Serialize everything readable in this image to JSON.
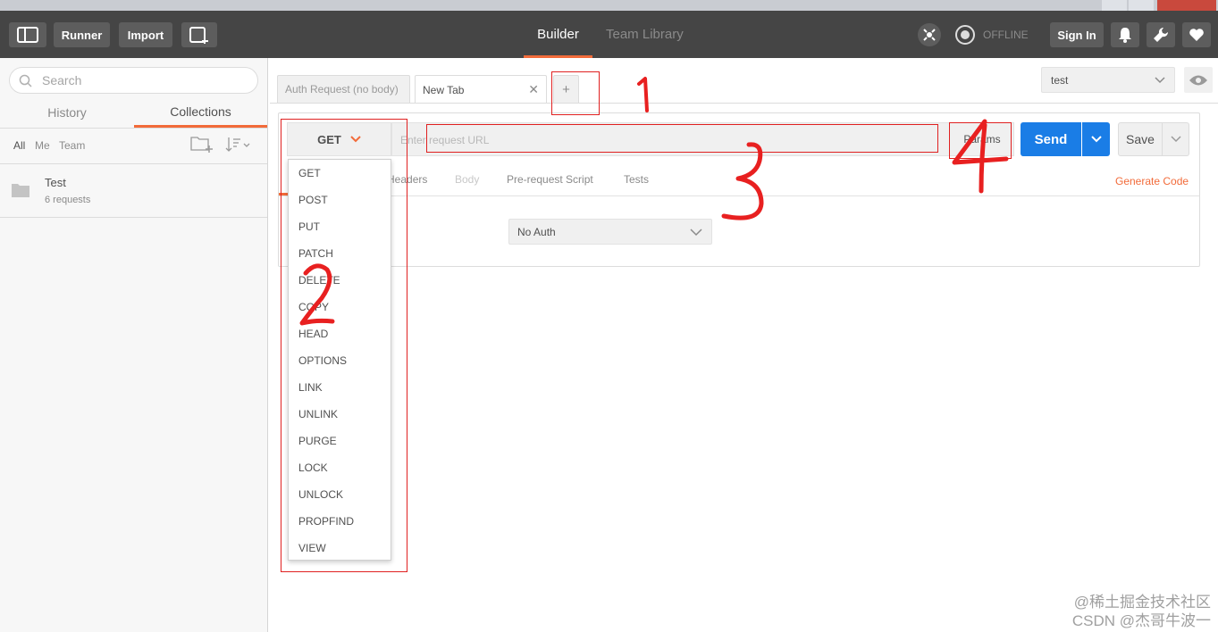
{
  "toolbar": {
    "runner_label": "Runner",
    "import_label": "Import",
    "tabs": {
      "builder": "Builder",
      "team_library": "Team Library"
    },
    "offline_label": "OFFLINE",
    "sign_in_label": "Sign In"
  },
  "sidebar": {
    "search_placeholder": "Search",
    "tabs": {
      "history": "History",
      "collections": "Collections"
    },
    "filters": {
      "all": "All",
      "me": "Me",
      "team": "Team"
    },
    "collection": {
      "name": "Test",
      "count": "6 requests"
    }
  },
  "request_tabs": [
    {
      "label": "Auth Request (no body)"
    },
    {
      "label": "New Tab"
    }
  ],
  "new_tab_label": "+",
  "environment": {
    "selected": "test"
  },
  "request": {
    "method": "GET",
    "url_placeholder": "Enter request URL",
    "params_label": "Params",
    "send_label": "Send",
    "save_label": "Save"
  },
  "subtabs": {
    "headers": "Headers",
    "body": "Body",
    "pre_request": "Pre-request Script",
    "tests": "Tests",
    "generate_code": "Generate Code"
  },
  "auth": {
    "selected": "No Auth"
  },
  "methods": [
    "GET",
    "POST",
    "PUT",
    "PATCH",
    "DELETE",
    "COPY",
    "HEAD",
    "OPTIONS",
    "LINK",
    "UNLINK",
    "PURGE",
    "LOCK",
    "UNLOCK",
    "PROPFIND",
    "VIEW"
  ],
  "watermark": {
    "line1": "@稀土掘金技术社区",
    "line2": "CSDN @杰哥牛波一"
  },
  "colors": {
    "accent": "#f26b3a",
    "send": "#1a7de6",
    "topbar": "#454545",
    "annotation": "#e02020"
  }
}
